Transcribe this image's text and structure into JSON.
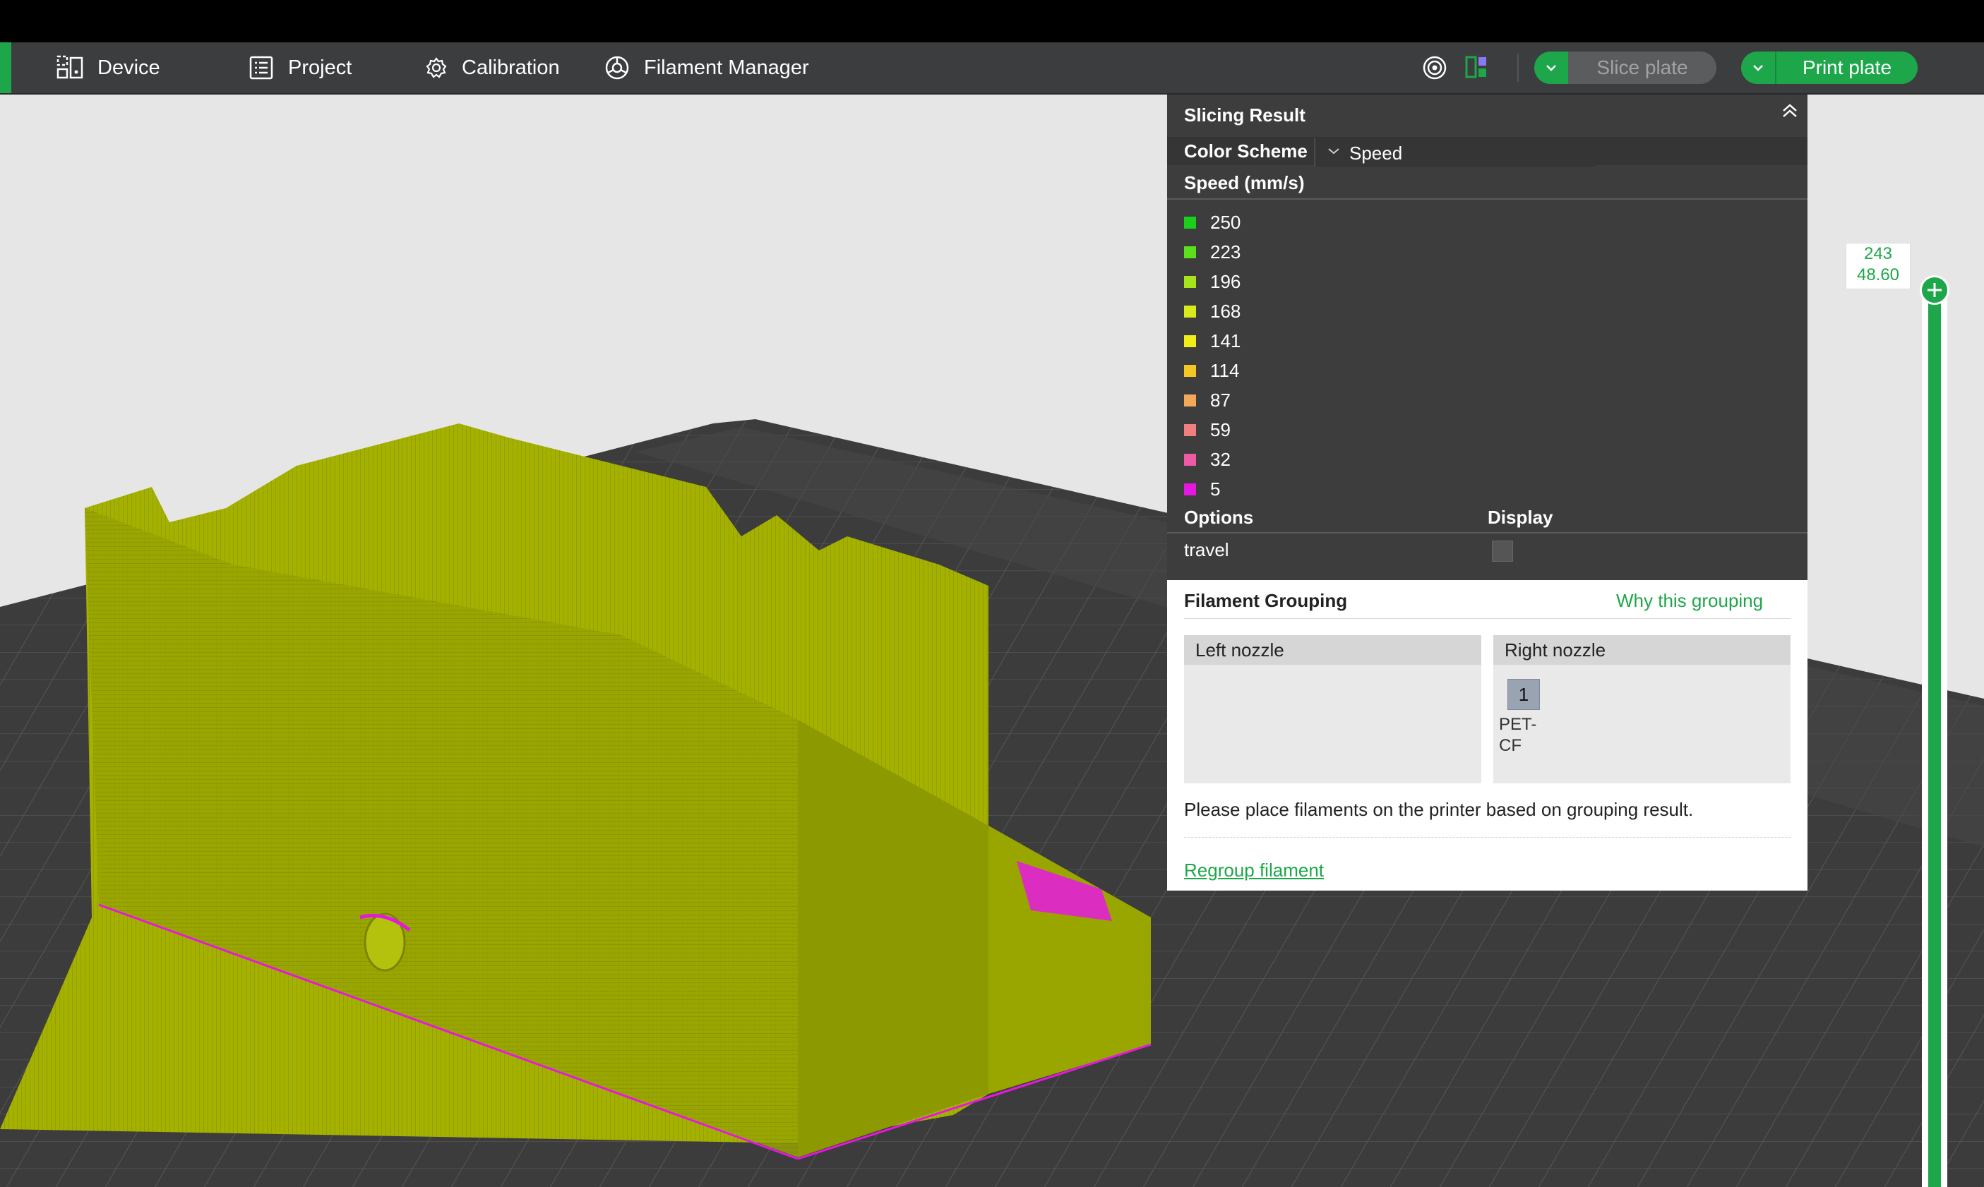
{
  "toolbar": {
    "nav": [
      {
        "label": "Device",
        "icon": "device-icon"
      },
      {
        "label": "Project",
        "icon": "project-icon"
      },
      {
        "label": "Calibration",
        "icon": "calibration-icon"
      },
      {
        "label": "Filament Manager",
        "icon": "filament-manager-icon"
      }
    ],
    "slice_label": "Slice plate",
    "print_label": "Print plate",
    "accent_color": "#1ea74a"
  },
  "slicing_result": {
    "title": "Slicing Result",
    "color_scheme_label": "Color Scheme",
    "color_scheme_value": "Speed",
    "speed_header": "Speed (mm/s)",
    "legend": [
      {
        "value": "250",
        "color": "#19d11a"
      },
      {
        "value": "223",
        "color": "#5ce01b"
      },
      {
        "value": "196",
        "color": "#a6e51c"
      },
      {
        "value": "168",
        "color": "#d8ea1c"
      },
      {
        "value": "141",
        "color": "#f2ec18"
      },
      {
        "value": "114",
        "color": "#f5c724"
      },
      {
        "value": "87",
        "color": "#f3a85a"
      },
      {
        "value": "59",
        "color": "#f07f7f"
      },
      {
        "value": "32",
        "color": "#ee5aa6"
      },
      {
        "value": "5",
        "color": "#e617e0"
      }
    ],
    "options_label": "Options",
    "display_label": "Display",
    "travel_label": "travel"
  },
  "filament_grouping": {
    "title": "Filament Grouping",
    "why_link": "Why this grouping",
    "left_nozzle": "Left nozzle",
    "right_nozzle": "Right nozzle",
    "filament_number": "1",
    "filament_type_line1": "PET-",
    "filament_type_line2": "CF",
    "message": "Please place filaments on the printer based on grouping result.",
    "regroup_link": "Regroup filament"
  },
  "layer_slider": {
    "layer": "243",
    "height": "48.60",
    "position": 1.0
  }
}
